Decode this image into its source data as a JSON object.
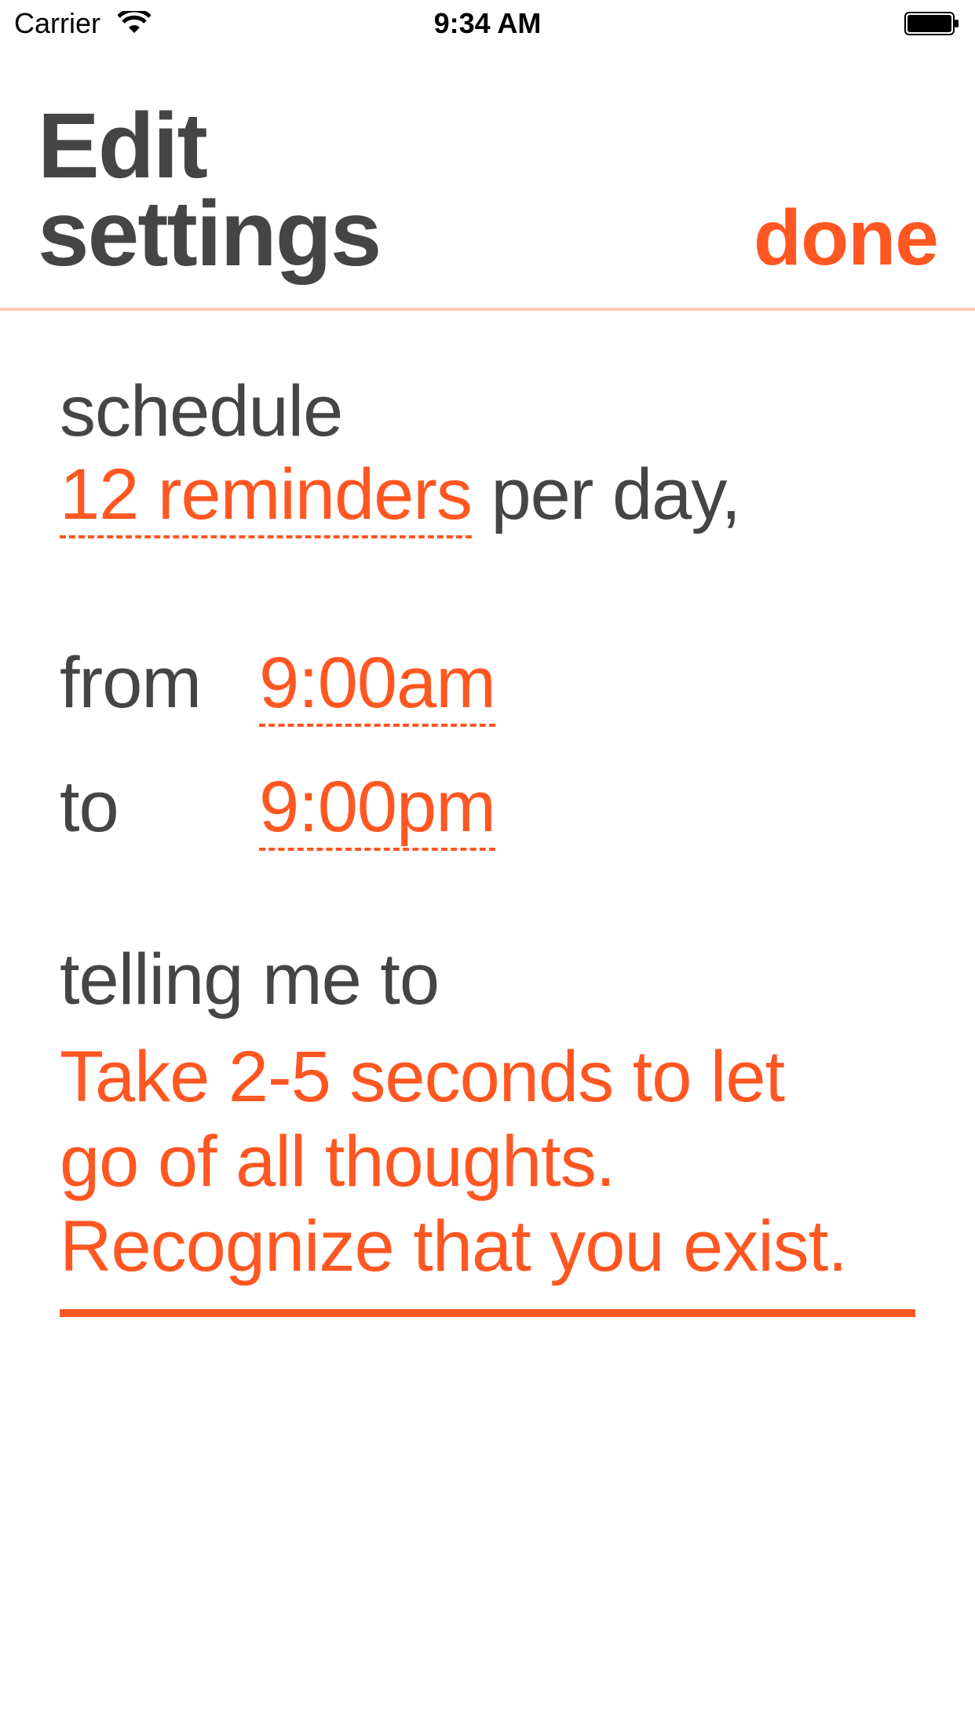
{
  "status_bar": {
    "carrier": "Carrier",
    "time": "9:34 AM",
    "wifi_icon": "wifi-icon",
    "battery_icon": "battery-icon"
  },
  "header": {
    "title_line1": "Edit",
    "title_line2": "settings",
    "done_label": "done"
  },
  "schedule": {
    "label": "schedule",
    "reminders_value": "12 reminders",
    "per_day_text": "per day,",
    "from_label": "from",
    "from_value": "9:00am",
    "to_label": "to",
    "to_value": "9:00pm"
  },
  "message": {
    "label": "telling me to",
    "line1": "Take 2-5 seconds to let",
    "line2": "go of all thoughts.",
    "line3": "Recognize that you exist."
  },
  "colors": {
    "accent": "#ff5722",
    "text": "#454545",
    "divider": "#ffc8b8",
    "background": "#ffffff"
  }
}
